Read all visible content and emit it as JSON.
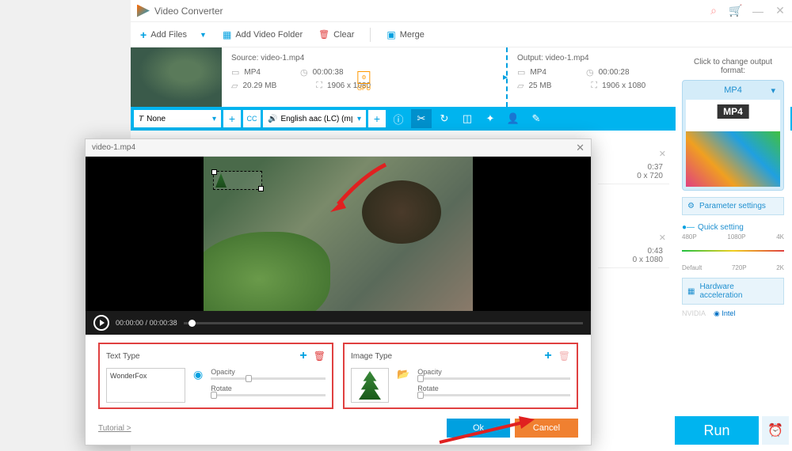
{
  "app": {
    "title": "Video Converter"
  },
  "toolbar": {
    "add_files": "Add Files",
    "add_folder": "Add Video Folder",
    "clear": "Clear",
    "merge": "Merge"
  },
  "source": {
    "label": "Source: video-1.mp4",
    "format": "MP4",
    "duration": "00:00:38",
    "size": "20.29 MB",
    "resolution": "1906 x 1080"
  },
  "output": {
    "label": "Output: video-1.mp4",
    "format": "MP4",
    "duration": "00:00:28",
    "size": "25 MB",
    "resolution": "1906 x 1080"
  },
  "gpu": "GPU",
  "editbar": {
    "subtitle": "None",
    "audio": "English aac (LC) (mן",
    "cc": "CC"
  },
  "bg_rows": [
    {
      "dur": "0:37",
      "res": "0 x 720"
    },
    {
      "dur": "0:43",
      "res": "0 x 1080"
    }
  ],
  "sidebar": {
    "change_label": "Click to change output format:",
    "format": "MP4",
    "mp4_logo": "MP4",
    "param": "Parameter settings",
    "quick": "Quick setting",
    "ticks_top": [
      "480P",
      "1080P",
      "4K"
    ],
    "ticks_bot": [
      "Default",
      "720P",
      "2K"
    ],
    "hw": "Hardware acceleration",
    "nvidia": "NVIDIA",
    "intel": "Intel",
    "run": "Run"
  },
  "editor": {
    "title": "video-1.mp4",
    "time_cur": "00:00:00",
    "time_dur": "00:00:38",
    "text_panel": {
      "title": "Text Type",
      "value": "WonderFox",
      "opacity": "Opacity",
      "rotate": "Rotate"
    },
    "image_panel": {
      "title": "Image Type",
      "opacity": "Opacity",
      "rotate": "Rotate"
    },
    "tutorial": "Tutorial >",
    "ok": "Ok",
    "cancel": "Cancel"
  }
}
